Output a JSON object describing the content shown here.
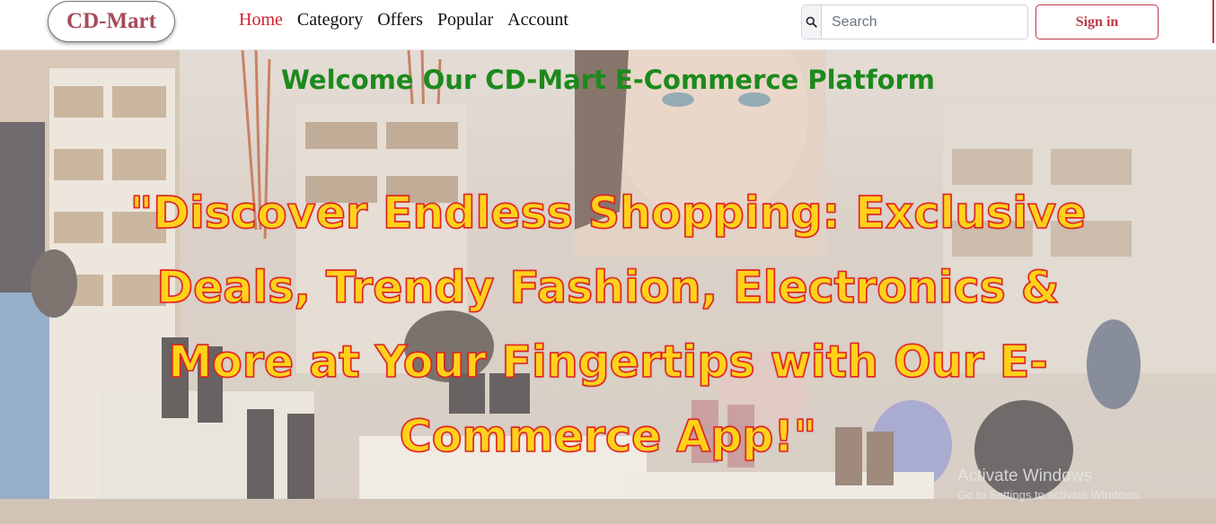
{
  "brand": {
    "name": "CD-Mart"
  },
  "nav": {
    "links": [
      {
        "label": "Home",
        "active": true
      },
      {
        "label": "Category",
        "active": false
      },
      {
        "label": "Offers",
        "active": false
      },
      {
        "label": "Popular",
        "active": false
      },
      {
        "label": "Account",
        "active": false
      }
    ]
  },
  "search": {
    "placeholder": "Search",
    "value": "",
    "icon": "search-icon"
  },
  "signin": {
    "label": "Sign in"
  },
  "hero": {
    "welcome": "Welcome Our CD-Mart E-Commerce Platform",
    "headline": "\"Discover Endless Shopping: Exclusive Deals, Trendy Fashion, Electronics & More at Your Fingertips with Our E-Commerce App!\"",
    "background": "shoe-store-interior-photo"
  },
  "watermark": {
    "title": "Activate Windows",
    "subtitle": "Go to Settings to activate Windows."
  },
  "colors": {
    "brand_text": "#a84a5a",
    "nav_active": "#d41f2a",
    "signin": "#c0394b",
    "welcome_text": "#1c8a1c",
    "headline_fill": "#ffd21a",
    "headline_stroke": "#e02222"
  }
}
